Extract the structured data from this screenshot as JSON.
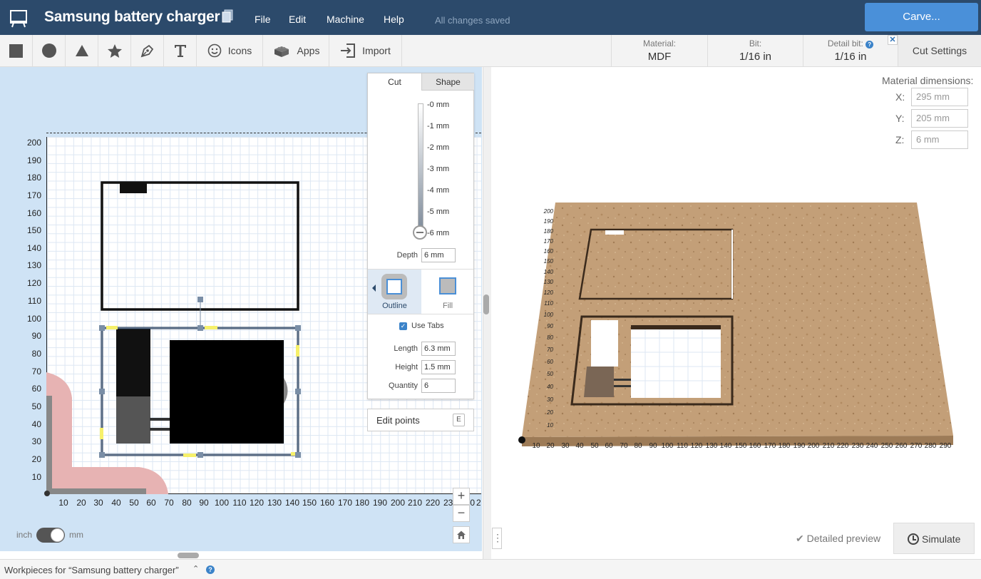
{
  "app": {
    "title": "Samsung battery charger",
    "status": "All changes saved",
    "carve_label": "Carve..."
  },
  "menu": [
    "File",
    "Edit",
    "Machine",
    "Help"
  ],
  "toolbar": {
    "icons_label": "Icons",
    "apps_label": "Apps",
    "import_label": "Import"
  },
  "material": {
    "material_key": "Material:",
    "material_val": "MDF",
    "bit_key": "Bit:",
    "bit_val": "1/16 in",
    "detail_key": "Detail bit:",
    "detail_val": "1/16 in",
    "cut_settings": "Cut Settings"
  },
  "canvas": {
    "y_ticks": [
      "200",
      "190",
      "180",
      "170",
      "160",
      "150",
      "140",
      "130",
      "120",
      "110",
      "100",
      "90",
      "80",
      "70",
      "60",
      "50",
      "40",
      "30",
      "20",
      "10"
    ],
    "x_ticks": [
      "10",
      "20",
      "30",
      "40",
      "50",
      "60",
      "70",
      "80",
      "90",
      "100",
      "110",
      "120",
      "130",
      "140",
      "150",
      "160",
      "170",
      "180",
      "190",
      "200",
      "210",
      "220",
      "230",
      "240",
      "2"
    ],
    "unit_inch": "inch",
    "unit_mm": "mm"
  },
  "cut_panel": {
    "tab_cut": "Cut",
    "tab_shape": "Shape",
    "depth_marks": [
      "-0 mm",
      "-1 mm",
      "-2 mm",
      "-3 mm",
      "-4 mm",
      "-5 mm",
      "-6 mm"
    ],
    "depth_label": "Depth",
    "depth_value": "6 mm",
    "outline_label": "Outline",
    "fill_label": "Fill",
    "use_tabs": "Use Tabs",
    "length_label": "Length",
    "length_value": "6.3 mm",
    "height_label": "Height",
    "height_value": "1.5 mm",
    "quantity_label": "Quantity",
    "quantity_value": "6",
    "edit_points": "Edit points",
    "edit_key": "E"
  },
  "preview": {
    "dims_title": "Material dimensions:",
    "x_label": "X:",
    "x_value": "295 mm",
    "y_label": "Y:",
    "y_value": "205 mm",
    "z_label": "Z:",
    "z_value": "6 mm",
    "x_ticks": [
      "10",
      "20",
      "30",
      "40",
      "50",
      "60",
      "70",
      "80",
      "90",
      "100",
      "110",
      "120",
      "130",
      "140",
      "150",
      "160",
      "170",
      "180",
      "190",
      "200",
      "210",
      "220",
      "230",
      "240",
      "250",
      "260",
      "270",
      "280",
      "290"
    ],
    "y_ticks": [
      "200",
      "190",
      "180",
      "170",
      "160",
      "150",
      "140",
      "130",
      "120",
      "110",
      "100",
      "90",
      "80",
      "70",
      "60",
      "50",
      "40",
      "30",
      "20",
      "10"
    ],
    "detailed_preview": "Detailed preview",
    "simulate": "Simulate"
  },
  "footer": {
    "workpieces": "Workpieces for “Samsung battery charger”"
  }
}
